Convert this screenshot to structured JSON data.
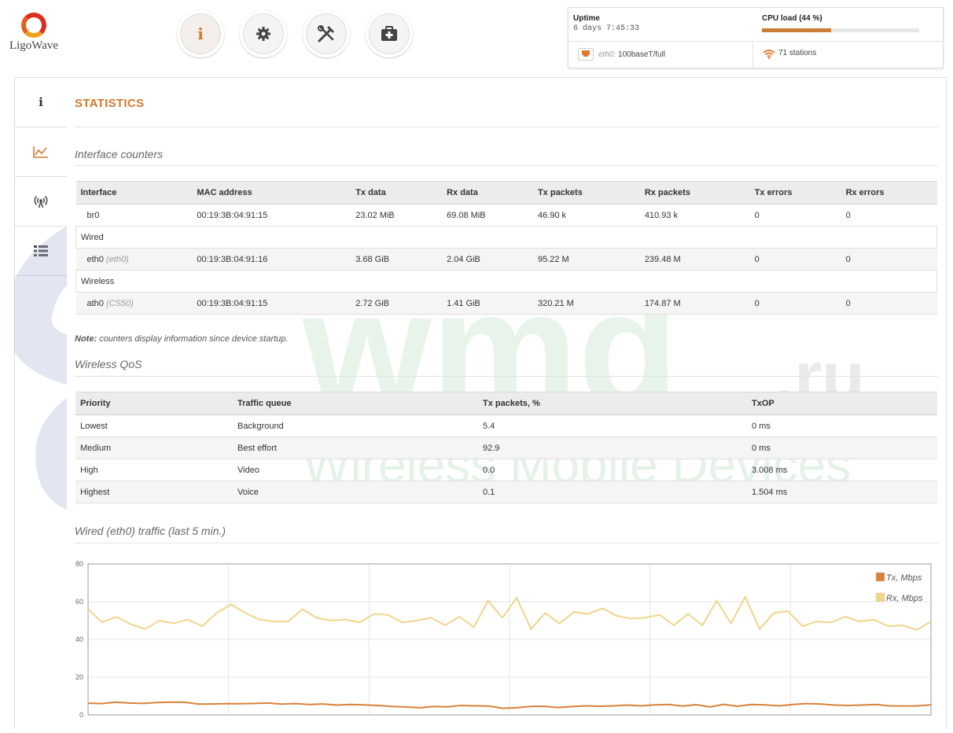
{
  "brand": {
    "name": "LigoWave"
  },
  "nav": [
    {
      "id": "info",
      "icon": "info-icon",
      "active": true
    },
    {
      "id": "settings",
      "icon": "gear-icon",
      "active": false
    },
    {
      "id": "tools",
      "icon": "tools-icon",
      "active": false
    },
    {
      "id": "support",
      "icon": "first-aid-icon",
      "active": false
    }
  ],
  "status": {
    "uptime_label": "Uptime",
    "uptime_value": "6 days 7:45:33",
    "cpu_label": "CPU load (44 %)",
    "cpu_load_fraction": 0.44,
    "eth_iface": "eth0:",
    "eth_state": "100baseT/full",
    "stations": "71 stations"
  },
  "sidebar": [
    {
      "icon": "info-icon",
      "active": false
    },
    {
      "icon": "statistics-chart-icon",
      "active": true
    },
    {
      "icon": "wireless-signal-icon",
      "active": false
    },
    {
      "icon": "list-icon",
      "active": false
    }
  ],
  "page": {
    "title": "STATISTICS",
    "interface_section": "Interface counters",
    "note_bold": "Note:",
    "note_text": " counters display information since device startup.",
    "qos_section": "Wireless QoS",
    "traffic_section": "Wired (eth0) traffic (last 5 min.)"
  },
  "interfaces": {
    "headers": [
      "Interface",
      "MAC address",
      "Tx data",
      "Rx data",
      "Tx packets",
      "Rx packets",
      "Tx errors",
      "Rx errors"
    ],
    "groups": {
      "wired": "Wired",
      "wireless": "Wireless"
    },
    "rows": {
      "br0": {
        "name": "br0",
        "alias": "",
        "mac": "00:19:3B:04:91:15",
        "tx_data": "23.02 MiB",
        "rx_data": "69.08 MiB",
        "tx_packets": "46.90 k",
        "rx_packets": "410.93 k",
        "tx_errors": "0",
        "rx_errors": "0"
      },
      "eth0": {
        "name": "eth0",
        "alias": "(eth0)",
        "mac": "00:19:3B:04:91:16",
        "tx_data": "3.68 GiB",
        "rx_data": "2.04 GiB",
        "tx_packets": "95.22 M",
        "rx_packets": "239.48 M",
        "tx_errors": "0",
        "rx_errors": "0"
      },
      "ath0": {
        "name": "ath0",
        "alias": "(CS50)",
        "mac": "00:19:3B:04:91:15",
        "tx_data": "2.72 GiB",
        "rx_data": "1.41 GiB",
        "tx_packets": "320.21 M",
        "rx_packets": "174.87 M",
        "tx_errors": "0",
        "rx_errors": "0"
      }
    }
  },
  "qos": {
    "headers": [
      "Priority",
      "Traffic queue",
      "Tx packets, %",
      "TxOP"
    ],
    "rows": [
      {
        "priority": "Lowest",
        "queue": "Background",
        "tx_pct": "5.4",
        "txop": "0 ms"
      },
      {
        "priority": "Medium",
        "queue": "Best effort",
        "tx_pct": "92.9",
        "txop": "0 ms"
      },
      {
        "priority": "High",
        "queue": "Video",
        "tx_pct": "0.0",
        "txop": "3.008 ms"
      },
      {
        "priority": "Highest",
        "queue": "Voice",
        "tx_pct": "0.1",
        "txop": "1.504 ms"
      }
    ]
  },
  "watermark": {
    "big": "wmd",
    "ru": ".ru",
    "sub": "Wireless Mobile Devices"
  },
  "colors": {
    "accent": "#d07a2e",
    "tx": "#d9823b",
    "rx": "#f0d68a"
  },
  "chart_data": {
    "type": "line",
    "title": "",
    "xlabel": "",
    "ylabel": "",
    "ylim": [
      0,
      80
    ],
    "yticks": [
      "0",
      "20",
      "40",
      "60",
      "80"
    ],
    "grid": true,
    "legend_position": "top-right",
    "series": [
      {
        "name": "Tx, Mbps",
        "color": "#d9823b",
        "values": [
          6.2,
          6.0,
          6.8,
          6.3,
          6.1,
          6.6,
          6.8,
          6.7,
          5.7,
          5.8,
          6.0,
          5.9,
          6.1,
          6.3,
          5.7,
          6.0,
          5.5,
          5.8,
          5.2,
          5.5,
          5.3,
          5.0,
          4.5,
          4.2,
          3.8,
          4.5,
          4.3,
          5.0,
          4.8,
          4.7,
          3.5,
          3.8,
          4.5,
          4.6,
          3.9,
          4.4,
          4.8,
          4.6,
          4.8,
          5.2,
          4.8,
          5.3,
          5.5,
          4.7,
          5.4,
          4.2,
          5.6,
          4.6,
          5.5,
          5.3,
          4.8,
          5.5,
          6.0,
          5.8,
          5.2,
          5.0,
          5.2,
          5.5,
          4.8,
          4.7,
          4.8,
          5.3
        ]
      },
      {
        "name": "Rx, Mbps",
        "color": "#f0d68a",
        "values": [
          56,
          49,
          52,
          48,
          45.5,
          50,
          48.5,
          50.5,
          47,
          54,
          58.5,
          54,
          50.5,
          49.5,
          49.5,
          56,
          51.5,
          50,
          50.5,
          49,
          53.5,
          53,
          49,
          50,
          51.5,
          47.5,
          52,
          46.5,
          60.5,
          51.5,
          62,
          45.5,
          54,
          48.5,
          54.5,
          53.5,
          56.5,
          52.5,
          51,
          51.5,
          53,
          47.5,
          53.5,
          47.5,
          60.5,
          48.5,
          62.5,
          45.5,
          54,
          55,
          47,
          49.5,
          49,
          52,
          49.5,
          50.5,
          47,
          47.5,
          45,
          49.5
        ]
      }
    ]
  }
}
